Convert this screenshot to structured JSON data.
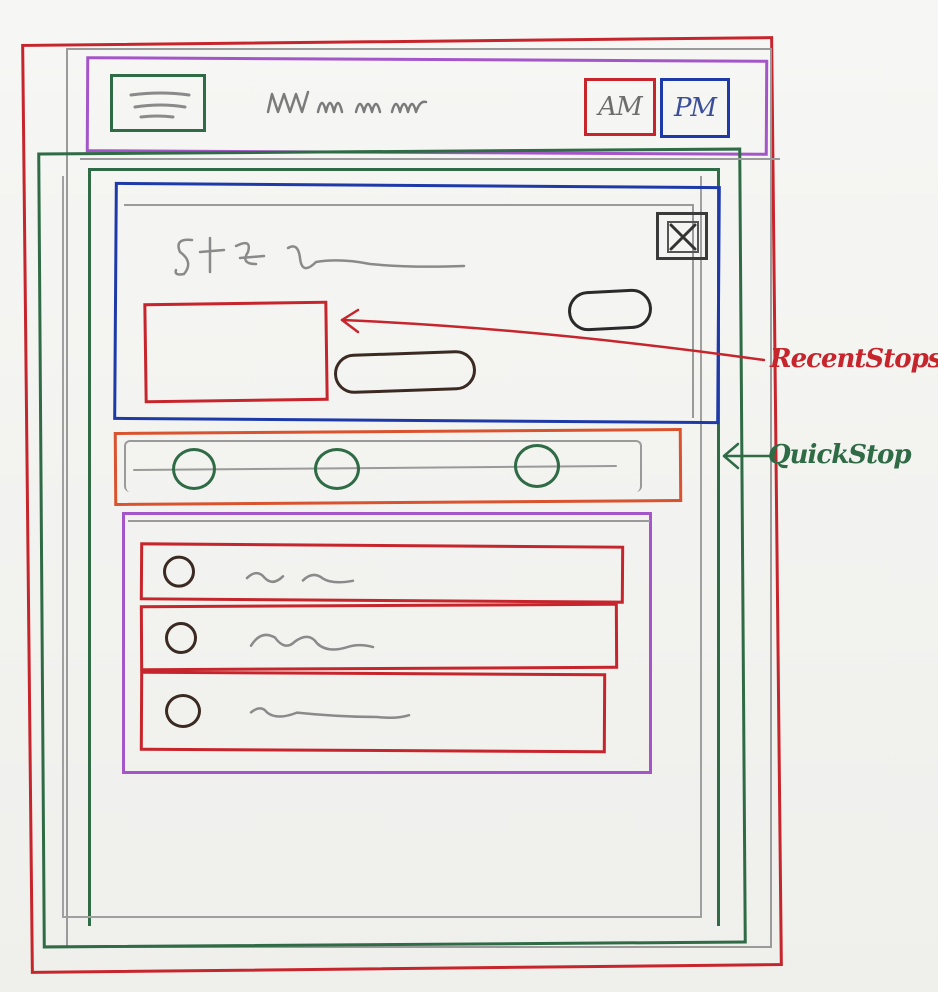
{
  "header": {
    "am_label": "AM",
    "pm_label": "PM"
  },
  "callouts": {
    "recent_stops": "RecentStops",
    "quick_stop": "QuickStop"
  },
  "colors": {
    "red": "#c6252c",
    "purple": "#a456c9",
    "green": "#2f6b45",
    "blue": "#1e3aa8",
    "orange": "#d9532f",
    "gray": "#8d8d8d",
    "dark": "#3a2a22"
  },
  "icons": {
    "menu": "hamburger-menu-icon",
    "close": "close-icon",
    "list_item": "circle-icon"
  }
}
